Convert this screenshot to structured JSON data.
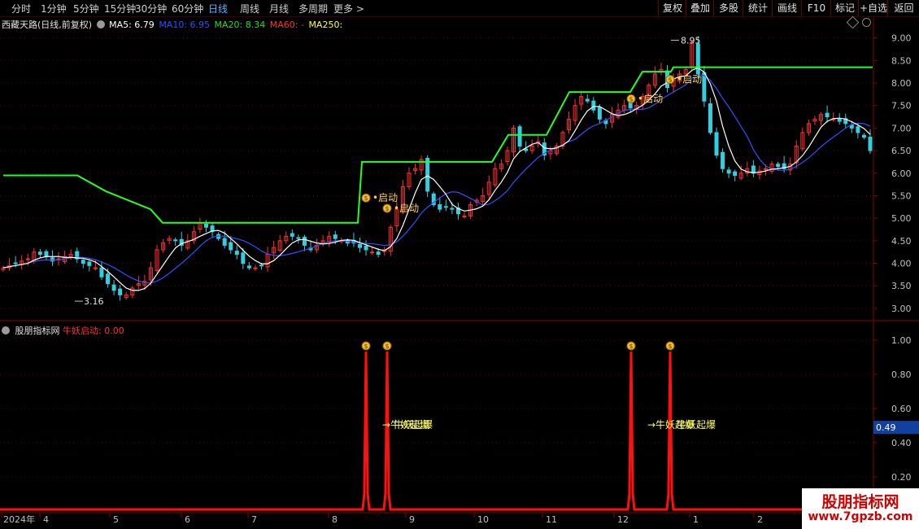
{
  "toolbar": {
    "periods": [
      "分时",
      "1分钟",
      "5分钟",
      "15分钟",
      "30分钟",
      "60分钟",
      "日线",
      "周线",
      "月线",
      "多周期",
      "更多"
    ],
    "active": "日线",
    "more_arrow": ">",
    "buttons": [
      "复权",
      "叠加",
      "多股",
      "统计",
      "画线",
      "F10",
      "标记",
      "+自选",
      "返回"
    ]
  },
  "main_legend": {
    "title": "西藏天路(日线,前复权)",
    "ma5": "MA5: 6.79",
    "ma10": "MA10: 6.95",
    "ma20": "MA20: 8.34",
    "ma60": "MA60: -",
    "ma250": "MA250:",
    "colors": {
      "ma5": "#ffffff",
      "ma10": "#3050ff",
      "ma20": "#22dd22",
      "ma60": "#ff2020",
      "ma250": "#ffff40"
    }
  },
  "sub_legend": {
    "title": "股朋指标网",
    "indicator": "牛妖启动: 0.00"
  },
  "price_axis": {
    "ticks": [
      "9.00",
      "8.50",
      "8.00",
      "7.50",
      "7.00",
      "6.50",
      "6.00",
      "5.50",
      "5.00",
      "4.50",
      "4.00",
      "3.50",
      "3.00"
    ]
  },
  "sub_axis": {
    "ticks": [
      "1.00",
      "0.80",
      "0.60",
      "0.40",
      "0.20"
    ],
    "current": "0.49"
  },
  "date_axis": {
    "labels": [
      "2024年",
      "4",
      "5",
      "6",
      "7",
      "8",
      "9",
      "10",
      "11",
      "12",
      "1",
      "2"
    ]
  },
  "annotations": {
    "high": "8.95",
    "low": "3.16",
    "signal": "启动",
    "burst": "牛妖起爆",
    "arrow": "→",
    "money_icon": "$"
  },
  "watermark": {
    "line1": "股朋指标网",
    "line2": "www.7gpzb.com"
  },
  "chart_data": {
    "type": "candlestick",
    "price_range": [
      2.8,
      9.3
    ],
    "closes": [
      3.9,
      3.95,
      4.0,
      4.05,
      4.1,
      4.25,
      4.2,
      4.15,
      4.05,
      4.1,
      4.15,
      4.2,
      4.1,
      4.0,
      3.95,
      3.9,
      3.7,
      3.55,
      3.4,
      3.3,
      3.3,
      3.45,
      3.55,
      3.6,
      3.9,
      4.3,
      4.45,
      4.55,
      4.5,
      4.4,
      4.5,
      4.7,
      4.9,
      4.8,
      4.7,
      4.55,
      4.4,
      4.3,
      4.2,
      4.0,
      3.9,
      3.9,
      3.95,
      4.2,
      4.35,
      4.5,
      4.6,
      4.6,
      4.55,
      4.4,
      4.3,
      4.4,
      4.5,
      4.6,
      4.55,
      4.5,
      4.45,
      4.45,
      4.35,
      4.3,
      4.25,
      4.2,
      4.3,
      4.8,
      5.2,
      5.7,
      6.0,
      6.1,
      6.3,
      5.6,
      5.3,
      5.2,
      5.25,
      5.2,
      5.1,
      5.05,
      5.3,
      5.4,
      5.5,
      5.8,
      6.1,
      6.2,
      6.5,
      7.0,
      6.6,
      6.5,
      6.6,
      6.7,
      6.4,
      6.5,
      6.6,
      6.9,
      7.2,
      7.5,
      7.7,
      7.6,
      7.4,
      7.2,
      7.1,
      7.3,
      7.4,
      7.5,
      7.45,
      7.5,
      7.7,
      7.95,
      8.2,
      8.3,
      7.9,
      8.1,
      8.2,
      8.3,
      8.9,
      8.2,
      7.6,
      6.9,
      6.4,
      6.1,
      6.0,
      5.95,
      6.0,
      6.1,
      6.0,
      6.05,
      6.1,
      6.2,
      6.15,
      6.1,
      6.2,
      6.6,
      6.9,
      7.1,
      7.2,
      7.3,
      7.25,
      7.2,
      7.15,
      7.1,
      7.0,
      6.9,
      6.8,
      6.5
    ],
    "ma20_steps": [
      {
        "from_date": "2024-01",
        "value": 5.95
      },
      {
        "from_date": "2024-05",
        "value": 4.9
      },
      {
        "from_date": "2024-08",
        "value": 6.25
      },
      {
        "from_date": "2024-09",
        "value": 6.25
      },
      {
        "from_date": "2024-10",
        "value": 6.85
      },
      {
        "from_date": "2024-11",
        "value": 7.8
      },
      {
        "from_date": "2024-12",
        "value": 8.25
      },
      {
        "from_date": "2024-12-end",
        "value": 8.35
      }
    ],
    "signal_indices": [
      66,
      72,
      121,
      127
    ],
    "signal_values": [
      1,
      1,
      1,
      1
    ],
    "high_value": 8.95,
    "low_value": 3.16
  }
}
